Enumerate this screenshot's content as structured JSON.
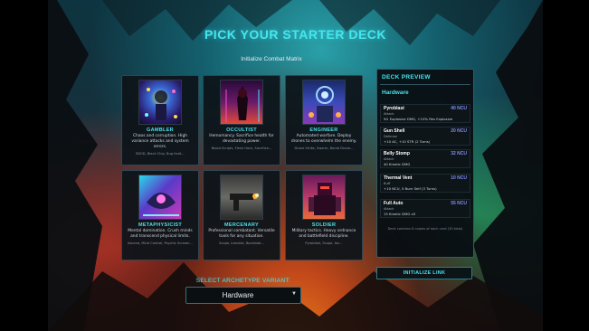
{
  "title": "PICK YOUR STARTER DECK",
  "subtitle": "Initialize Combat Matrix",
  "cards": [
    {
      "name": "GAMBLER",
      "desc": "Chaos and corruption. High variance attacks and system errors.",
      "tags": "BSOD, Black Chip, Bug fault..."
    },
    {
      "name": "OCCULTIST",
      "desc": "Hemomancy. Sacrifice health for devastating power.",
      "tags": "Blood Scripts, Flesh Hack, Sacrifice..."
    },
    {
      "name": "ENGINEER",
      "desc": "Automated warfare. Deploy drones to overwhelm the enemy.",
      "tags": "Drone Strike, Swarm, Bomb Drone..."
    },
    {
      "name": "METAPHYSICIST",
      "desc": "Mental domination. Crush minds and transcend physical limits.",
      "tags": "Ascend, Mind Control, Psychic Scream..."
    },
    {
      "name": "MERCENARY",
      "desc": "Professional combatant. Versatile tools for any situation.",
      "tags": "Scope, Ironside, Backstab..."
    },
    {
      "name": "SOLDIER",
      "desc": "Military tactics. Heavy ordnance and battlefield discipline.",
      "tags": "Pyroblast, Scope, Ion..."
    }
  ],
  "preview": {
    "heading": "DECK PREVIEW",
    "deck_name": "Hardware",
    "entries": [
      {
        "name": "Pyroblast",
        "cost": "40 NCU",
        "type": "Attack",
        "detail": "5G Explosive DMG, +10% Res Explosive"
      },
      {
        "name": "Gun Shell",
        "cost": "20 NCU",
        "type": "Defense",
        "detail": "+10 AC, +10 STR (2 Turns)"
      },
      {
        "name": "Belly Stomp",
        "cost": "32 NCU",
        "type": "Attack",
        "detail": "40 Kinetic DMG"
      },
      {
        "name": "Thermal Vent",
        "cost": "10 NCU",
        "type": "Buff",
        "detail": "+10 NCU, 5 Burn Self (3 Turns)"
      },
      {
        "name": "Full Auto",
        "cost": "55 NCU",
        "type": "Attack",
        "detail": "15 Kinetic DMG x5"
      }
    ],
    "note": "Deck contains 6 copies of each card (30 total)"
  },
  "init_button": "INITIALIZE LINK",
  "select_label": "SELECT ARCHETYPE VARIANT:",
  "select_value": "Hardware",
  "colors": {
    "accent": "#44e6ee",
    "cost": "#7d8cf2",
    "panel": "#0d141a"
  }
}
